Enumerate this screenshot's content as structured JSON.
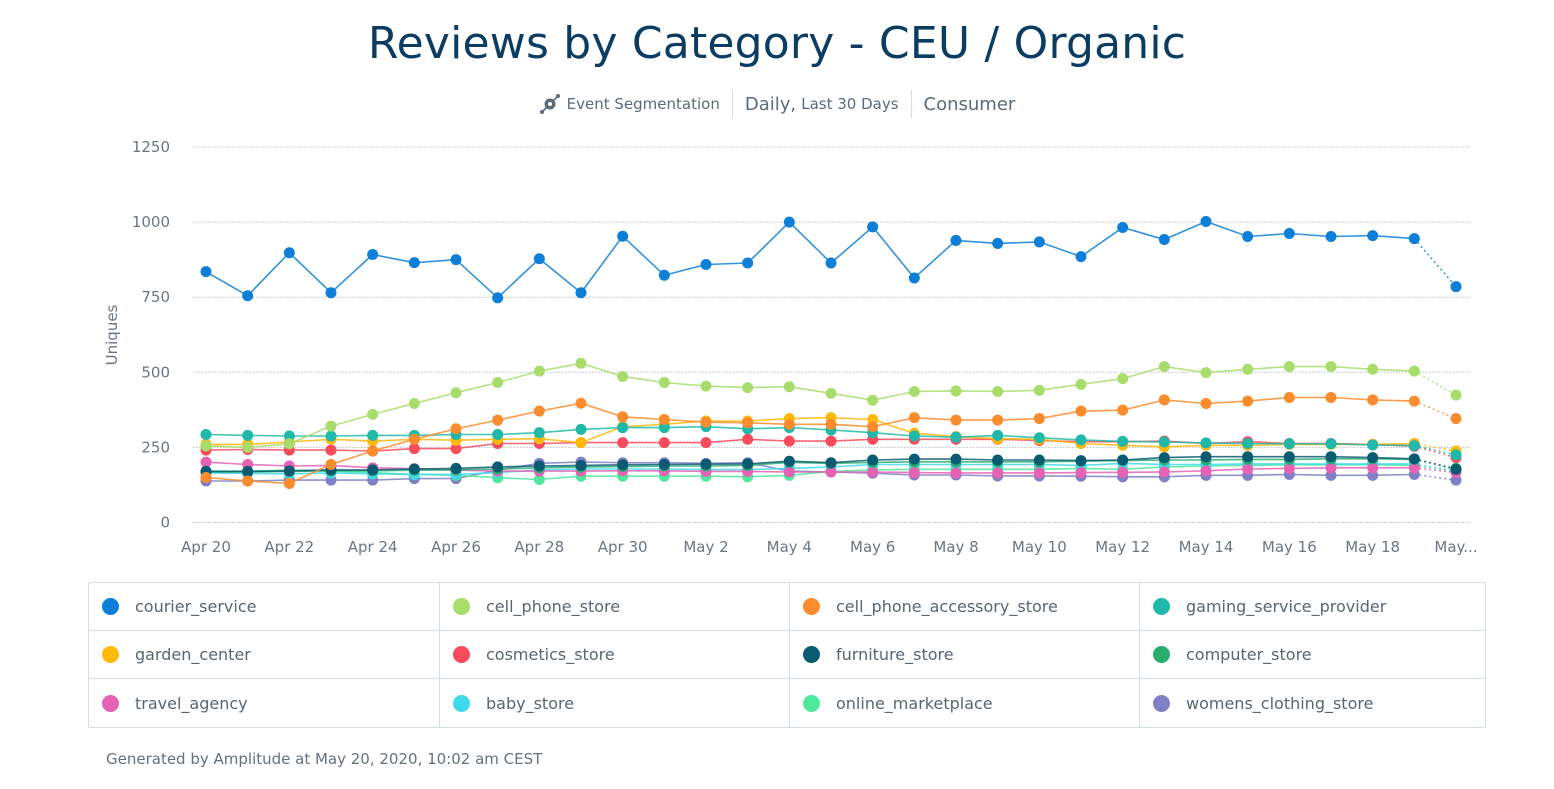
{
  "header": {
    "title": "Reviews by Category - CEU / Organic",
    "chart_type_label": "Event Segmentation",
    "chart_type_icon": "event-segmentation-icon",
    "interval_label": "Daily,",
    "range_label": "Last 30 Days",
    "segment_label": "Consumer"
  },
  "footer": {
    "generated_text": "Generated by Amplitude at May 20, 2020, 10:02 am CEST"
  },
  "chart_data": {
    "type": "line",
    "title": "Reviews by Category - CEU / Organic",
    "xlabel": "",
    "ylabel": "Uniques",
    "ylim": [
      0,
      1250
    ],
    "yticks": [
      0,
      250,
      500,
      750,
      1000,
      1250
    ],
    "grid": true,
    "legend_position": "bottom",
    "x": [
      "Apr 20",
      "Apr 21",
      "Apr 22",
      "Apr 23",
      "Apr 24",
      "Apr 25",
      "Apr 26",
      "Apr 27",
      "Apr 28",
      "Apr 29",
      "Apr 30",
      "May 1",
      "May 2",
      "May 3",
      "May 4",
      "May 5",
      "May 6",
      "May 7",
      "May 8",
      "May 9",
      "May 10",
      "May 11",
      "May 12",
      "May 13",
      "May 14",
      "May 15",
      "May 16",
      "May 17",
      "May 18",
      "May 19",
      "May 20"
    ],
    "xtick_labels": [
      "Apr 20",
      "",
      "Apr 22",
      "",
      "Apr 24",
      "",
      "Apr 26",
      "",
      "Apr 28",
      "",
      "Apr 30",
      "",
      "May 2",
      "",
      "May 4",
      "",
      "May 6",
      "",
      "May 8",
      "",
      "May 10",
      "",
      "May 12",
      "",
      "May 14",
      "",
      "May 16",
      "",
      "May 18",
      "",
      "May..."
    ],
    "last_point_incomplete": true,
    "series": [
      {
        "name": "courier_service",
        "color": "#0e7fd8",
        "values": [
          835,
          755,
          898,
          765,
          892,
          865,
          875,
          748,
          878,
          765,
          953,
          823,
          859,
          864,
          1000,
          864,
          984,
          814,
          939,
          929,
          934,
          885,
          982,
          942,
          1002,
          952,
          962,
          952,
          955,
          945,
          785
        ]
      },
      {
        "name": "cell_phone_store",
        "color": "#a8dd6c",
        "values": [
          255,
          250,
          262,
          321,
          360,
          396,
          432,
          466,
          504,
          530,
          486,
          466,
          454,
          449,
          452,
          430,
          407,
          436,
          438,
          436,
          440,
          460,
          479,
          519,
          499,
          510,
          519,
          519,
          510,
          504,
          424
        ]
      },
      {
        "name": "cell_phone_accessory_store",
        "color": "#fb8c2e",
        "values": [
          150,
          138,
          130,
          193,
          238,
          277,
          312,
          341,
          371,
          397,
          352,
          343,
          334,
          332,
          327,
          327,
          319,
          349,
          341,
          341,
          346,
          371,
          374,
          408,
          396,
          404,
          416,
          416,
          408,
          404,
          346
        ]
      },
      {
        "name": "gaming_service_provider",
        "color": "#20b8a8",
        "values": [
          293,
          290,
          288,
          288,
          290,
          290,
          293,
          293,
          299,
          310,
          316,
          316,
          319,
          312,
          316,
          308,
          299,
          288,
          284,
          290,
          282,
          275,
          270,
          268,
          265,
          263,
          262,
          262,
          258,
          256,
          225
        ]
      },
      {
        "name": "garden_center",
        "color": "#ffb90a",
        "values": [
          260,
          260,
          268,
          277,
          271,
          277,
          274,
          277,
          279,
          266,
          319,
          327,
          338,
          338,
          346,
          349,
          343,
          297,
          286,
          279,
          277,
          263,
          257,
          252,
          257,
          257,
          260,
          260,
          260,
          263,
          238
        ]
      },
      {
        "name": "cosmetics_store",
        "color": "#f84c5c",
        "values": [
          241,
          243,
          241,
          241,
          238,
          246,
          246,
          263,
          263,
          266,
          266,
          266,
          266,
          277,
          271,
          271,
          277,
          277,
          277,
          277,
          273,
          269,
          269,
          271,
          263,
          269,
          263,
          263,
          260,
          254,
          216
        ]
      },
      {
        "name": "furniture_store",
        "color": "#0a5a72",
        "values": [
          170,
          170,
          172,
          175,
          175,
          178,
          180,
          185,
          188,
          190,
          192,
          193,
          194,
          195,
          204,
          199,
          208,
          211,
          211,
          208,
          208,
          206,
          208,
          216,
          219,
          219,
          219,
          219,
          216,
          212,
          177
        ]
      },
      {
        "name": "computer_store",
        "color": "#2aae70",
        "values": [
          168,
          168,
          170,
          172,
          172,
          174,
          175,
          178,
          182,
          185,
          186,
          188,
          188,
          190,
          200,
          197,
          200,
          202,
          202,
          202,
          202,
          204,
          206,
          208,
          208,
          210,
          210,
          212,
          212,
          210,
          180
        ]
      },
      {
        "name": "travel_agency",
        "color": "#e662b4",
        "values": [
          201,
          193,
          188,
          190,
          182,
          179,
          174,
          171,
          171,
          171,
          172,
          172,
          170,
          170,
          168,
          168,
          168,
          166,
          165,
          165,
          165,
          166,
          167,
          168,
          172,
          178,
          180,
          182,
          182,
          182,
          166
        ]
      },
      {
        "name": "baby_store",
        "color": "#3fd9ec",
        "values": [
          165,
          163,
          162,
          165,
          162,
          160,
          160,
          166,
          175,
          178,
          178,
          178,
          176,
          176,
          180,
          185,
          193,
          193,
          193,
          193,
          193,
          190,
          197,
          193,
          193,
          195,
          195,
          195,
          195,
          195,
          172
        ]
      },
      {
        "name": "online_marketplace",
        "color": "#4ee89c",
        "values": [
          171,
          171,
          174,
          171,
          166,
          160,
          157,
          149,
          143,
          154,
          154,
          154,
          154,
          152,
          157,
          170,
          175,
          177,
          177,
          177,
          177,
          180,
          177,
          185,
          188,
          190,
          192,
          192,
          192,
          190,
          168
        ]
      },
      {
        "name": "womens_clothing_store",
        "color": "#7f80c6",
        "values": [
          138,
          138,
          141,
          141,
          141,
          146,
          146,
          174,
          197,
          201,
          199,
          199,
          197,
          199,
          171,
          168,
          164,
          158,
          158,
          155,
          155,
          154,
          152,
          152,
          157,
          157,
          160,
          157,
          157,
          160,
          141
        ]
      }
    ]
  },
  "legend": {
    "items": [
      {
        "label": "courier_service",
        "color": "#0e7fd8"
      },
      {
        "label": "cell_phone_store",
        "color": "#a8dd6c"
      },
      {
        "label": "cell_phone_accessory_store",
        "color": "#fb8c2e"
      },
      {
        "label": "gaming_service_provider",
        "color": "#20b8a8"
      },
      {
        "label": "garden_center",
        "color": "#ffb90a"
      },
      {
        "label": "cosmetics_store",
        "color": "#f84c5c"
      },
      {
        "label": "furniture_store",
        "color": "#0a5a72"
      },
      {
        "label": "computer_store",
        "color": "#2aae70"
      },
      {
        "label": "travel_agency",
        "color": "#e662b4"
      },
      {
        "label": "baby_store",
        "color": "#3fd9ec"
      },
      {
        "label": "online_marketplace",
        "color": "#4ee89c"
      },
      {
        "label": "womens_clothing_store",
        "color": "#7f80c6"
      }
    ]
  }
}
